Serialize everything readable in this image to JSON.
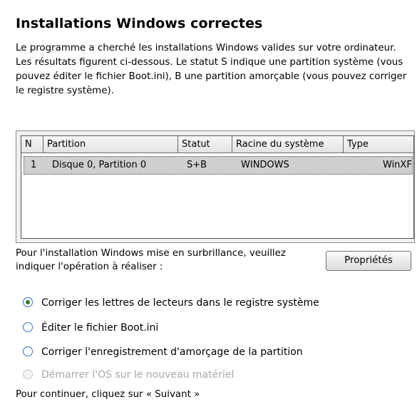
{
  "page": {
    "title": "Installations Windows correctes",
    "description": "Le programme a cherché les installations Windows valides sur votre ordinateur. Les résultats figurent ci-dessous. Le statut S indique une partition système (vous pouvez éditer le fichier Boot.ini), B une partition amorçable (vous pouvez corriger le registre système).",
    "prompt": "Pour l'installation Windows mise en surbrillance, veuillez indiquer l'opération à réaliser :",
    "properties_button": "Propriétés",
    "footer": "Pour continuer, cliquez sur « Suivant »"
  },
  "table": {
    "columns": [
      "N",
      "Partition",
      "Statut",
      "Racine du système",
      "Type"
    ],
    "rows": [
      [
        "1",
        "Disque 0, Partition 0",
        "S+B",
        "WINDOWS",
        "WinXF"
      ]
    ]
  },
  "options": [
    {
      "label": "Corriger les lettres de lecteurs dans le registre système",
      "selected": true,
      "enabled": true
    },
    {
      "label": "Éditer le fichier Boot.ini",
      "selected": false,
      "enabled": true
    },
    {
      "label": "Corriger l'enregistrement d'amorçage de la partition",
      "selected": false,
      "enabled": true
    },
    {
      "label": "Démarrer l'OS sur le nouveau matériel",
      "selected": false,
      "enabled": false
    }
  ],
  "colors": {
    "selected_row": "#cfcfcf",
    "radio_border": "#3c6fb3",
    "radio_dot": "#2a7a2a"
  }
}
